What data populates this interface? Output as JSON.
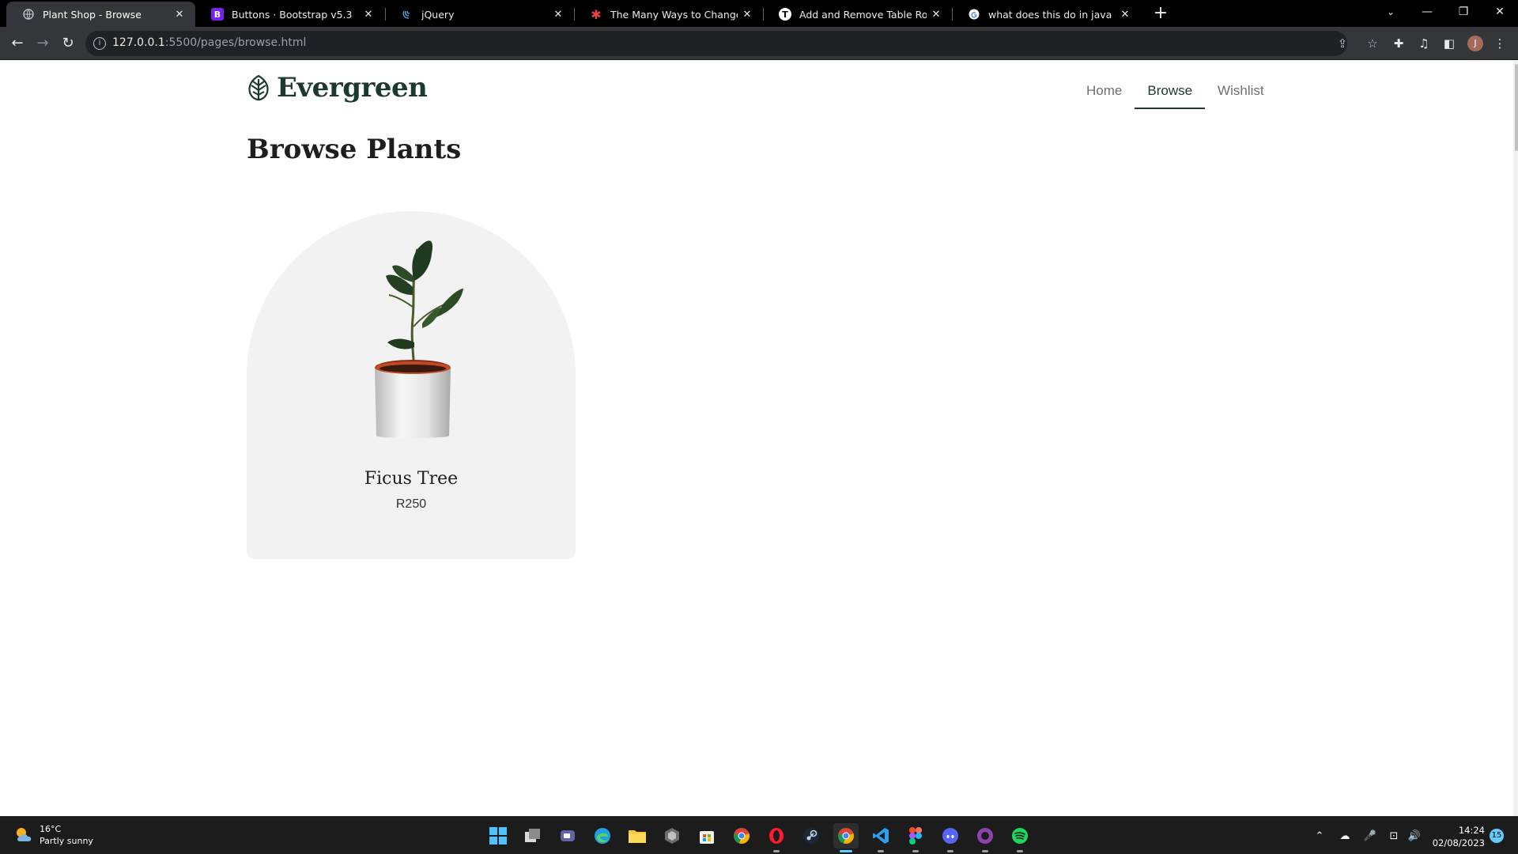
{
  "browser": {
    "tabs": [
      {
        "title": "Plant Shop - Browse",
        "icon": "globe-icon",
        "active": true
      },
      {
        "title": "Buttons · Bootstrap v5.3",
        "icon": "bootstrap-icon",
        "active": false
      },
      {
        "title": "jQuery",
        "icon": "jquery-icon",
        "active": false
      },
      {
        "title": "The Many Ways to Change an SV",
        "icon": "css-tricks-icon",
        "active": false
      },
      {
        "title": "Add and Remove Table Rows Dy",
        "icon": "t-icon",
        "active": false
      },
      {
        "title": "what does this do in java - Goog",
        "icon": "google-icon",
        "active": false
      }
    ],
    "close_glyph": "✕",
    "new_tab_glyph": "+",
    "url_host": "127.0.0.1",
    "url_rest": ":5500/pages/browse.html",
    "profile_initial": "J"
  },
  "site": {
    "brand": "Evergreen",
    "nav": [
      {
        "label": "Home",
        "active": false
      },
      {
        "label": "Browse",
        "active": true
      },
      {
        "label": "Wishlist",
        "active": false
      }
    ],
    "title": "Browse Plants",
    "products": [
      {
        "name": "Ficus Tree",
        "price": "R250"
      }
    ],
    "colors": {
      "brand": "#1c3a2b",
      "card_bg": "#f2f2f2",
      "nav_text": "#6c6f73"
    }
  },
  "taskbar": {
    "weather_temp": "16°C",
    "weather_desc": "Partly sunny",
    "time": "14:24",
    "date": "02/08/2023",
    "notification_count": "15",
    "apps": [
      "windows-start-icon",
      "task-view-icon",
      "teams-icon",
      "edge-icon",
      "file-explorer-icon",
      "app-icon",
      "store-icon",
      "chrome-icon",
      "opera-icon",
      "steam-icon",
      "chrome-icon",
      "vscode-icon",
      "figma-icon",
      "discord-icon",
      "github-desktop-icon",
      "spotify-icon"
    ]
  }
}
